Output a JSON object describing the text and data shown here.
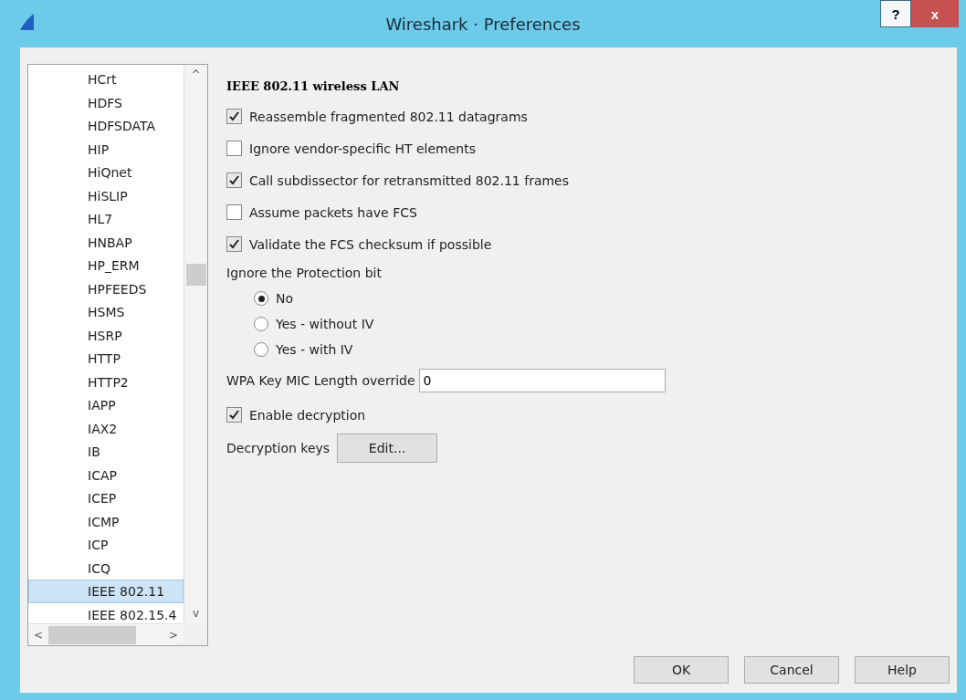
{
  "window": {
    "title": "Wireshark · Preferences",
    "buttons": [
      "?",
      "x"
    ]
  },
  "sidebar": {
    "items": [
      {
        "label": "HCrt",
        "selected": false
      },
      {
        "label": "HDFS",
        "selected": false
      },
      {
        "label": "HDFSDATA",
        "selected": false
      },
      {
        "label": "HIP",
        "selected": false
      },
      {
        "label": "HiQnet",
        "selected": false
      },
      {
        "label": "HiSLIP",
        "selected": false
      },
      {
        "label": "HL7",
        "selected": false
      },
      {
        "label": "HNBAP",
        "selected": false
      },
      {
        "label": "HP_ERM",
        "selected": false
      },
      {
        "label": "HPFEEDS",
        "selected": false
      },
      {
        "label": "HSMS",
        "selected": false
      },
      {
        "label": "HSRP",
        "selected": false
      },
      {
        "label": "HTTP",
        "selected": false
      },
      {
        "label": "HTTP2",
        "selected": false
      },
      {
        "label": "IAPP",
        "selected": false
      },
      {
        "label": "IAX2",
        "selected": false
      },
      {
        "label": "IB",
        "selected": false
      },
      {
        "label": "ICAP",
        "selected": false
      },
      {
        "label": "ICEP",
        "selected": false
      },
      {
        "label": "ICMP",
        "selected": false
      },
      {
        "label": "ICP",
        "selected": false
      },
      {
        "label": "ICQ",
        "selected": false
      },
      {
        "label": "IEEE 802.11",
        "selected": true
      },
      {
        "label": "IEEE 802.15.4",
        "selected": false
      }
    ],
    "scroll_up": "^",
    "scroll_down": "v",
    "scroll_left": "<",
    "scroll_right": ">"
  },
  "settings": [
    {
      "kind": "heading",
      "label": "IEEE 802.11 wireless LAN"
    },
    {
      "kind": "checkbox",
      "label": "Reassemble fragmented 802.11 datagrams",
      "checked": true
    },
    {
      "kind": "checkbox",
      "label": "Ignore vendor-specific HT elements",
      "checked": false
    },
    {
      "kind": "checkbox",
      "label": "Call subdissector for retransmitted 802.11 frames",
      "checked": true
    },
    {
      "kind": "checkbox",
      "label": "Assume packets have FCS",
      "checked": false
    },
    {
      "kind": "checkbox",
      "label": "Validate the FCS checksum if possible",
      "checked": true
    },
    {
      "kind": "label",
      "label": "Ignore the Protection bit"
    },
    {
      "kind": "radio",
      "label": "No",
      "selected": true
    },
    {
      "kind": "radio",
      "label": "Yes - without IV",
      "selected": false
    },
    {
      "kind": "radio",
      "label": "Yes - with IV",
      "selected": false
    },
    {
      "kind": "field",
      "label": "WPA Key MIC Length override",
      "value": "0"
    },
    {
      "kind": "checkbox",
      "label": "Enable decryption",
      "checked": true
    },
    {
      "kind": "button",
      "label": "Decryption keys",
      "button": "Edit..."
    }
  ],
  "buttons": [
    "OK",
    "Cancel",
    "Help"
  ]
}
